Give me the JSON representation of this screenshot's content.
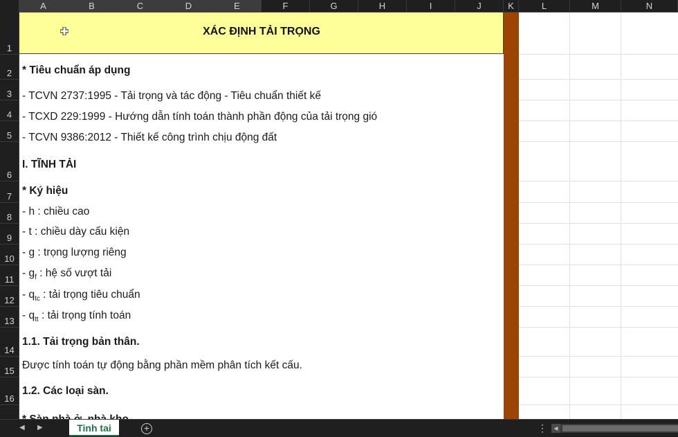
{
  "columns": [
    "A",
    "B",
    "C",
    "D",
    "E",
    "F",
    "G",
    "H",
    "I",
    "J",
    "K",
    "L",
    "M",
    "N"
  ],
  "rows": [
    "1",
    "2",
    "3",
    "4",
    "5",
    "6",
    "7",
    "8",
    "9",
    "10",
    "11",
    "12",
    "13",
    "14",
    "15",
    "16"
  ],
  "title": "XÁC ĐỊNH TẢI TRỌNG",
  "lines": {
    "r2": "* Tiêu chuẩn áp dụng",
    "r3": "- TCVN 2737:1995 - Tải trọng và tác động - Tiêu chuẩn thiết kế",
    "r4": "- TCXD 229:1999 - Hướng dẫn tính toán thành phần động của tải trọng gió",
    "r5": "- TCVN 9386:2012 - Thiết kế công trình chịu động đất",
    "r6": "I. TĨNH TẢI",
    "r7": "* Ký hiệu",
    "r8": "- h : chiều cao",
    "r9": "- t : chiều dày cấu kiện",
    "r10": "- g : trọng lượng riêng",
    "r11_pre": "- g",
    "r11_sub": "f",
    "r11_post": " : hệ số vượt tải",
    "r12_pre": "- q",
    "r12_sub": "tc",
    "r12_post": " : tải trọng tiêu chuẩn",
    "r13_pre": "- q",
    "r13_sub": "tt",
    "r13_post": " : tải trọng tính toán",
    "r14": "1.1. Tải trọng bản thân.",
    "r15": "Được tính toán tự động bằng phần mềm phân tích kết cấu.",
    "r16": "1.2. Các loại sàn.",
    "r17_partial": "* Sàn nhà ở, nhà kho"
  },
  "sheet_tab": "Tinh tai",
  "colors": {
    "title_fill": "#ffff99",
    "separator_column": "#9c4306",
    "sheet_tab_text": "#1e7145"
  }
}
